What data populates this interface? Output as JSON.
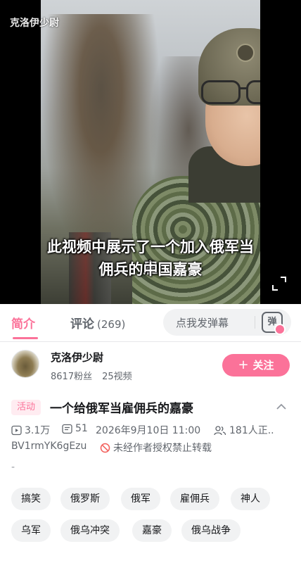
{
  "video": {
    "channel_tag": "克洛伊少尉",
    "subtitle_line1": "此视频中展示了一个加入俄军当雇",
    "subtitle_line2": "佣兵的中国嘉豪"
  },
  "tabs": {
    "intro": "简介",
    "comments": "评论",
    "comments_count": "(269)"
  },
  "danmaku": {
    "placeholder": "点我发弹幕",
    "toggle_label": "弹"
  },
  "uploader": {
    "name": "克洛伊少尉",
    "fans": "8617粉丝",
    "videos": "25视频",
    "follow_label": "关注"
  },
  "title": {
    "badge": "活动",
    "text": "一个给俄军当雇佣兵的嘉豪"
  },
  "meta": {
    "plays": "3.1万",
    "danmaku_count": "51",
    "date": "2026年9月10日 11:00",
    "watching": "181人正.."
  },
  "bvid": "BV1rmYK6gEzu",
  "copyright_notice": "未经作者授权禁止转载",
  "description": "-",
  "tags": [
    "搞笑",
    "俄罗斯",
    "俄军",
    "雇佣兵",
    "神人",
    "乌军",
    "俄乌冲突",
    "嘉豪",
    "俄乌战争"
  ],
  "colors": {
    "accent": "#fb7299",
    "secondary_text": "#61666d",
    "tag_bg": "#f1f2f3"
  }
}
